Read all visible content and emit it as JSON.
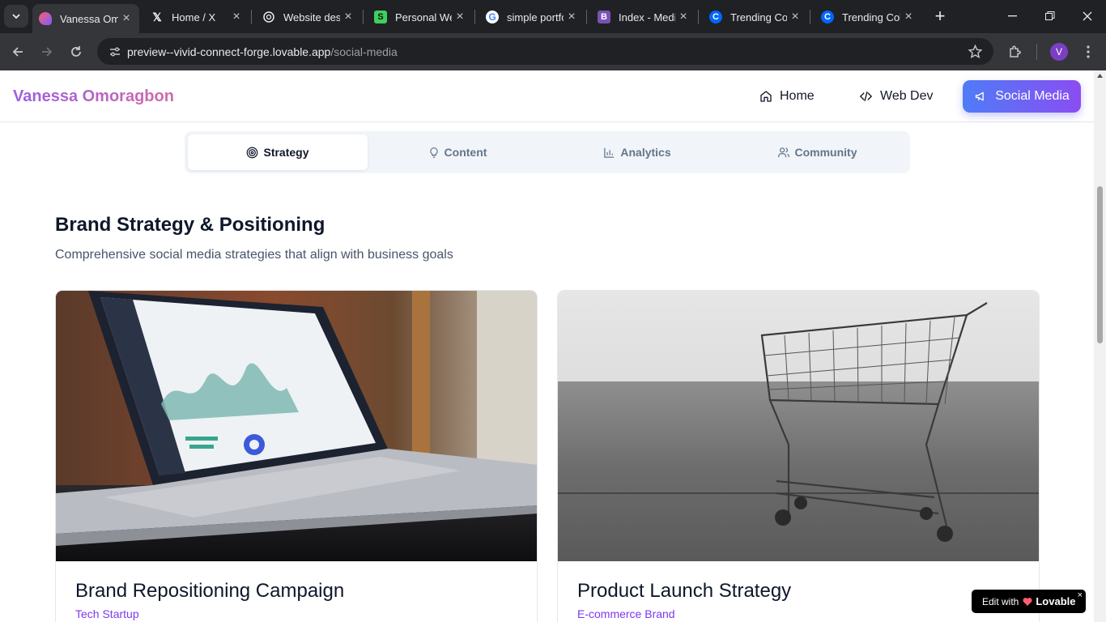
{
  "browser": {
    "tabs": [
      {
        "title": "Vanessa Omoragbon",
        "active": true,
        "icon": "lovable-heart-icon"
      },
      {
        "title": "Home / X",
        "active": false,
        "icon": "x-logo-icon"
      },
      {
        "title": "Website design",
        "active": false,
        "icon": "openai-icon"
      },
      {
        "title": "Personal Website",
        "active": false,
        "icon": "green-s-icon"
      },
      {
        "title": "simple portfolio",
        "active": false,
        "icon": "google-g-icon"
      },
      {
        "title": "Index - Medium",
        "active": false,
        "icon": "bootstrap-b-icon"
      },
      {
        "title": "Trending Colors",
        "active": false,
        "icon": "coolors-icon"
      },
      {
        "title": "Trending Colors",
        "active": false,
        "icon": "coolors-icon"
      }
    ],
    "url_host": "preview--vivid-connect-forge.lovable.app",
    "url_path": "/social-media",
    "profile_initial": "V"
  },
  "nav": {
    "brand": "Vanessa Omoragbon",
    "links": {
      "home": "Home",
      "webdev": "Web Dev",
      "social": "Social Media"
    }
  },
  "tabs": {
    "strategy": "Strategy",
    "content": "Content",
    "analytics": "Analytics",
    "community": "Community"
  },
  "section": {
    "title": "Brand Strategy & Positioning",
    "subtitle": "Comprehensive social media strategies that align with business goals"
  },
  "cards": [
    {
      "title": "Brand Repositioning Campaign",
      "tag": "Tech Startup",
      "image": "laptop-dashboard-photo"
    },
    {
      "title": "Product Launch Strategy",
      "tag": "E-commerce Brand",
      "image": "shopping-cart-photo"
    }
  ],
  "badge": {
    "prefix": "Edit with",
    "brand": "Lovable",
    "close": "×"
  },
  "colors": {
    "brand_gradient_start": "#9b5de5",
    "brand_gradient_end": "#d16ba5",
    "cta_start": "#4f7cf7",
    "cta_end": "#8a4df2",
    "tag": "#7c3aed"
  }
}
